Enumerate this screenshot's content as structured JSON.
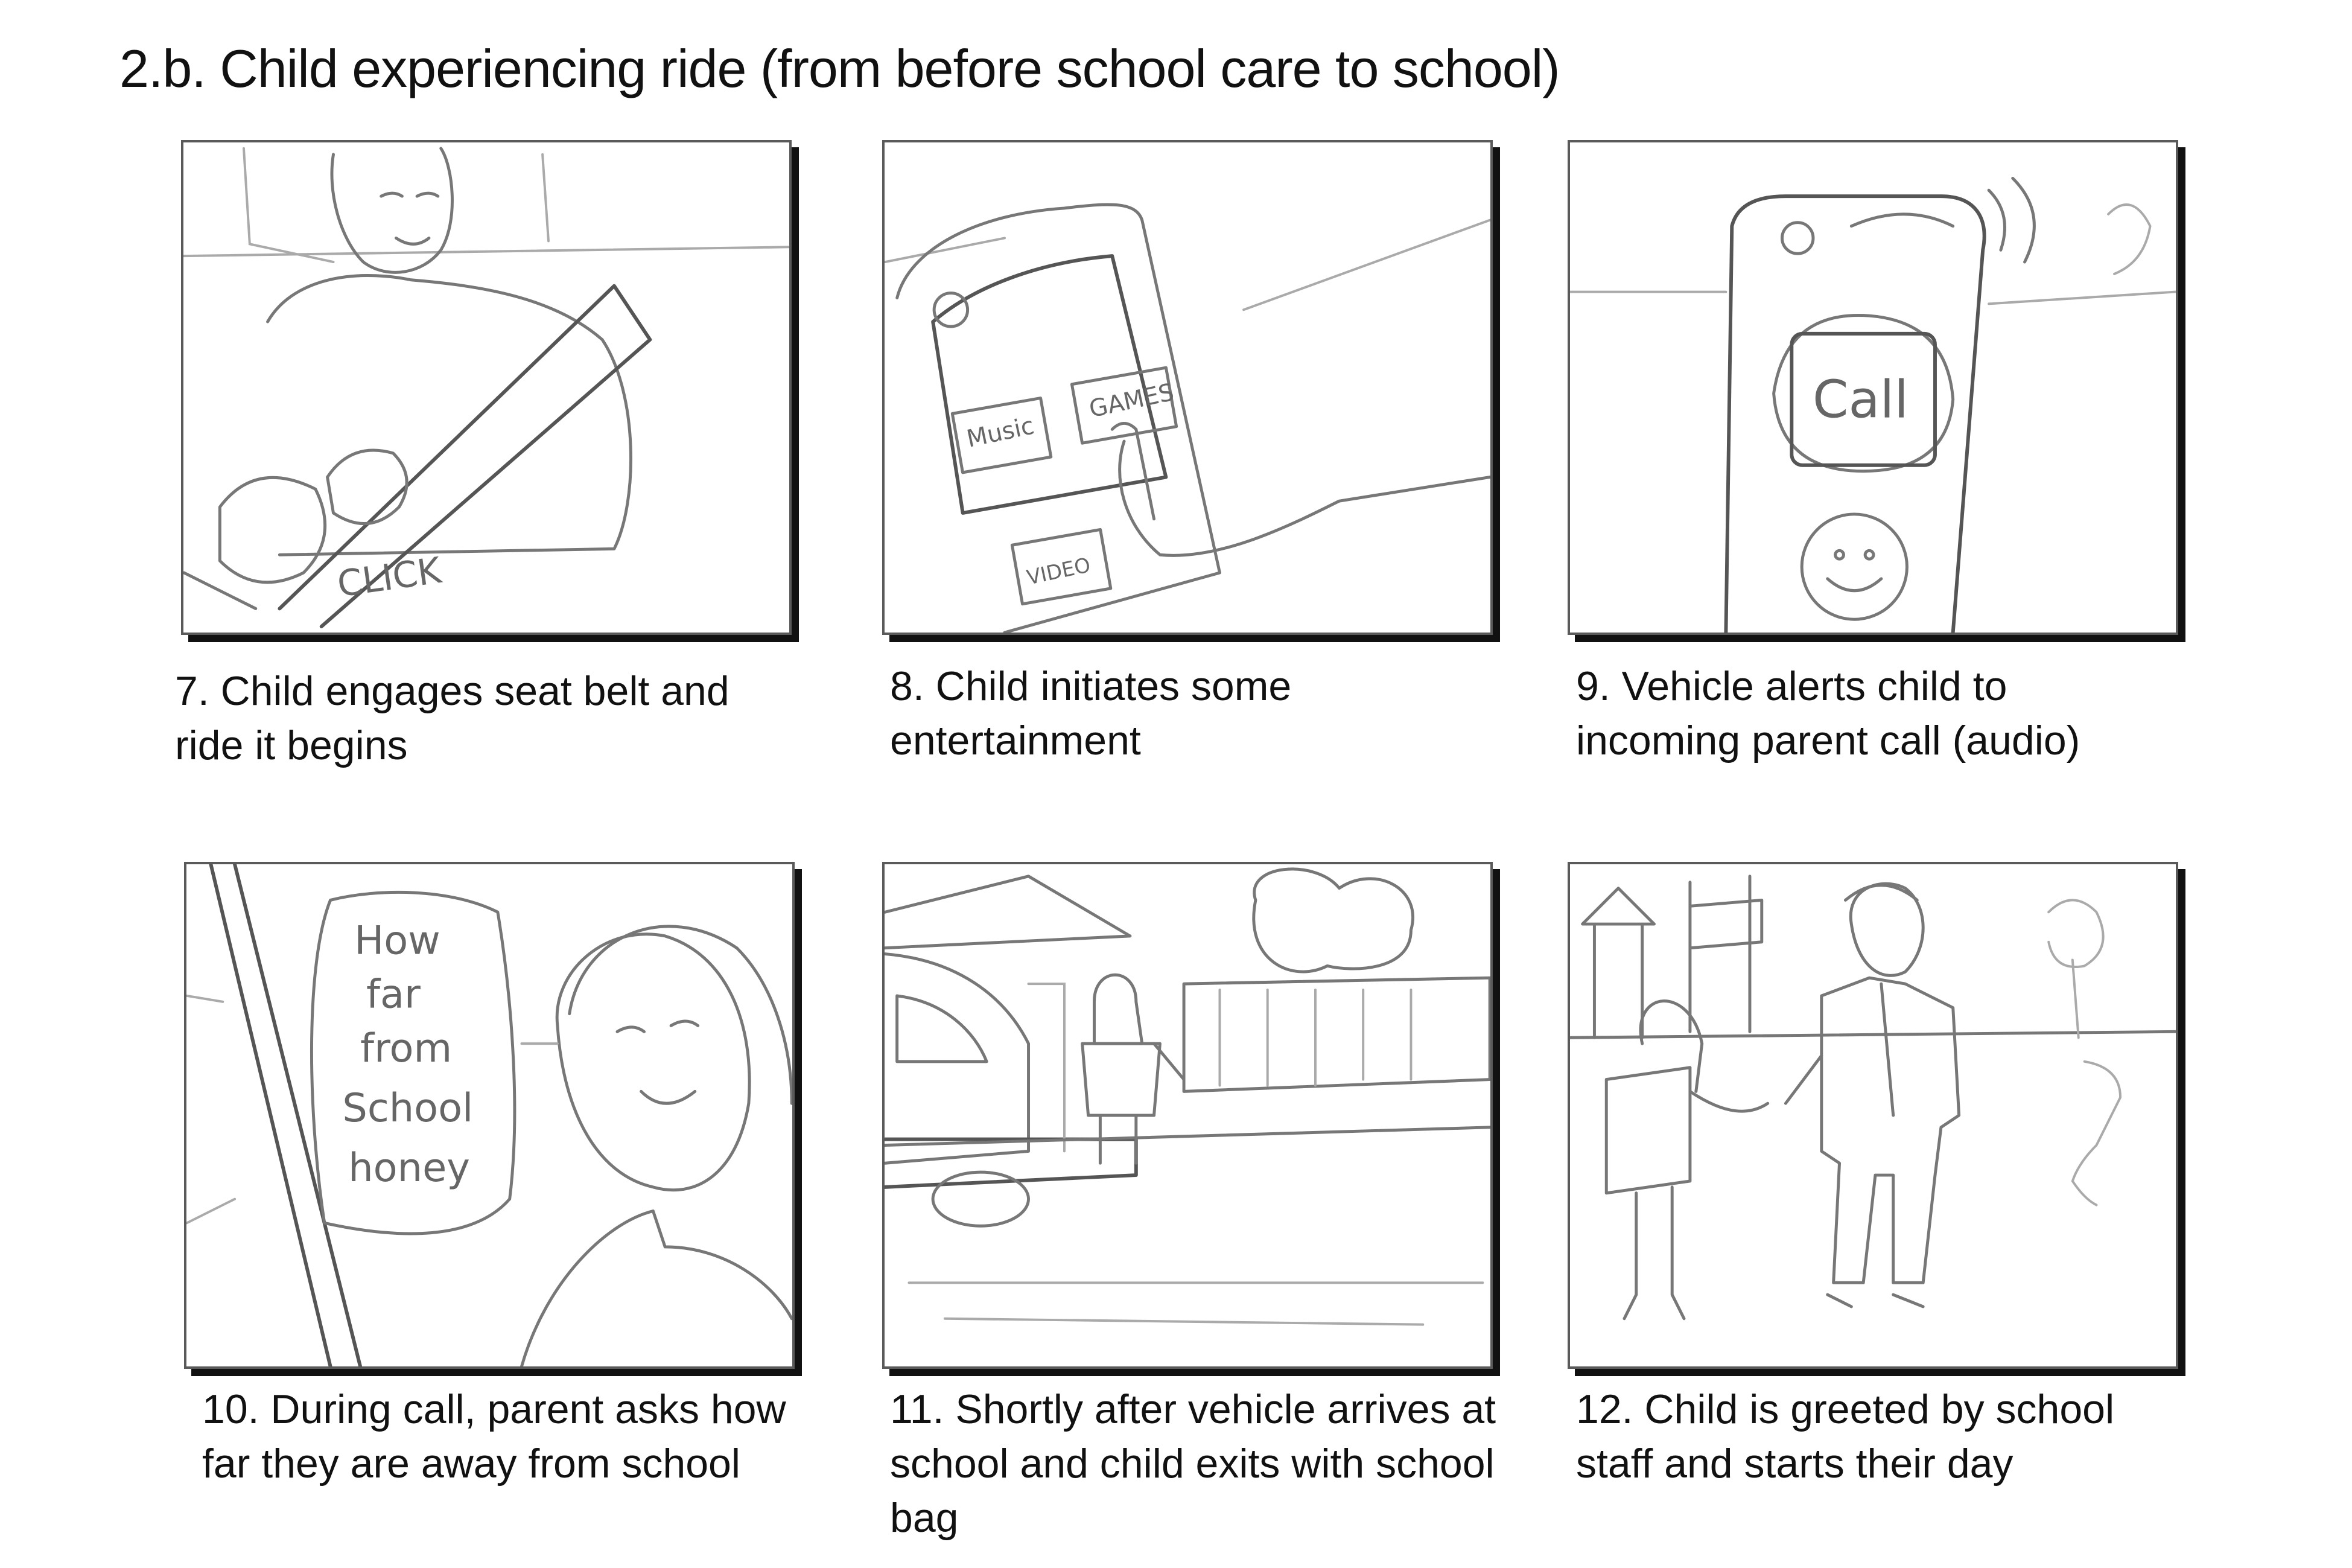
{
  "title": "2.b. Child experiencing ride (from before school care to school)",
  "panels": [
    {
      "caption": "7. Child engages seat belt and ride it begins",
      "sketch_text": "CLICK"
    },
    {
      "caption": "8. Child initiates some entertainment",
      "sketch_text": {
        "music": "Music",
        "games": "GAMES",
        "video": "VIDEO"
      }
    },
    {
      "caption": "9. Vehicle alerts child to incoming parent call (audio)",
      "sketch_text": "Call"
    },
    {
      "caption": "10. During call, parent asks how far they are away from school",
      "sketch_text": [
        "How",
        "far",
        "from",
        "School",
        "honey"
      ]
    },
    {
      "caption": "11. Shortly after vehicle arrives at school and child exits with school bag"
    },
    {
      "caption": "12. Child is greeted by school staff and starts their day"
    }
  ]
}
